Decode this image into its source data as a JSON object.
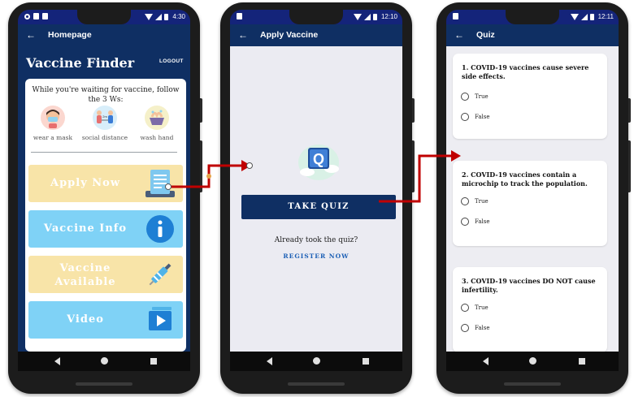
{
  "phones": [
    {
      "status_time": "4:30",
      "appbar_title": "Homepage"
    },
    {
      "status_time": "12:10",
      "appbar_title": "Apply Vaccine"
    },
    {
      "status_time": "12:11",
      "appbar_title": "Quiz"
    }
  ],
  "homepage": {
    "title": "Vaccine Finder",
    "logout_label": "LOGOUT",
    "waiting_text": "While you're waiting for vaccine, follow the 3 Ws:",
    "ws": [
      {
        "label": "wear a mask",
        "icon": "mask-icon"
      },
      {
        "label": "social distance",
        "icon": "social-distance-icon"
      },
      {
        "label": "wash hand",
        "icon": "wash-hand-icon"
      }
    ],
    "menu": [
      {
        "label": "Apply Now",
        "color": "#f8e4a8",
        "icon": "form-icon"
      },
      {
        "label": "Vaccine Info",
        "color": "#7fd2f6",
        "icon": "info-icon"
      },
      {
        "label": "Vaccine Available",
        "color": "#f8e4a8",
        "icon": "syringe-icon"
      },
      {
        "label": "Video",
        "color": "#7fd2f6",
        "icon": "video-icon"
      }
    ]
  },
  "apply_vaccine": {
    "take_quiz_label": "TAKE QUIZ",
    "already_text": "Already took the quiz?",
    "register_label": "REGISTER NOW"
  },
  "quiz": {
    "questions": [
      {
        "text": "1. COVID-19 vaccines cause severe side effects.",
        "options": [
          "True",
          "False"
        ]
      },
      {
        "text": "2. COVID-19 vaccines contain a microchip to track the population.",
        "options": [
          "True",
          "False"
        ]
      },
      {
        "text": "3. COVID-19 vaccines DO NOT cause infertility.",
        "options": [
          "True",
          "False"
        ]
      }
    ]
  },
  "colors": {
    "appbar": "#0f2f63",
    "statusbar": "#14247a",
    "arrow": "#c00000",
    "register_link": "#1b5fb5"
  }
}
